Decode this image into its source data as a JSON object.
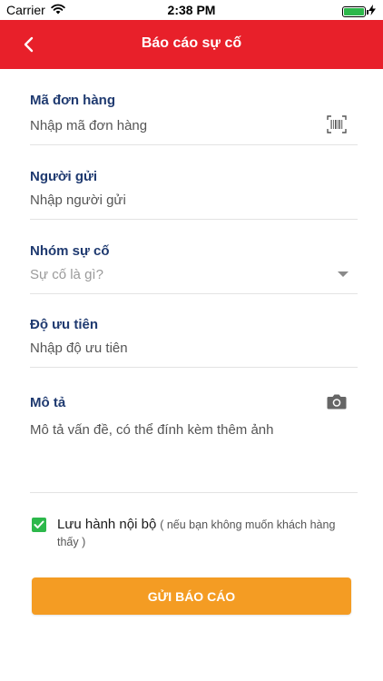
{
  "status_bar": {
    "carrier": "Carrier",
    "time": "2:38 PM",
    "battery_level": 1.0,
    "battery_color": "#2db84b"
  },
  "header": {
    "title": "Báo cáo sự cố",
    "background_color": "#e8202a"
  },
  "form": {
    "order_code": {
      "label": "Mã đơn hàng",
      "placeholder": "Nhập mã đơn hàng",
      "icon": "barcode-icon"
    },
    "sender": {
      "label": "Người gửi",
      "placeholder": "Nhập người gửi"
    },
    "incident_group": {
      "label": "Nhóm sự cố",
      "placeholder": "Sự cố là gì?",
      "icon": "chevron-down-icon"
    },
    "priority": {
      "label": "Độ ưu tiên",
      "placeholder": "Nhập độ ưu tiên"
    },
    "description": {
      "label": "Mô tả",
      "placeholder": "Mô tả vấn đề, có thể đính kèm thêm ảnh",
      "icon": "camera-icon"
    }
  },
  "internal_option": {
    "checked": true,
    "label": "Lưu hành nội bộ",
    "note": "( nếu bạn không muốn khách hàng thấy )"
  },
  "submit": {
    "label": "GỬI BÁO CÁO",
    "color": "#f49c23"
  },
  "colors": {
    "label": "#1f3a70",
    "check": "#2db84b"
  }
}
